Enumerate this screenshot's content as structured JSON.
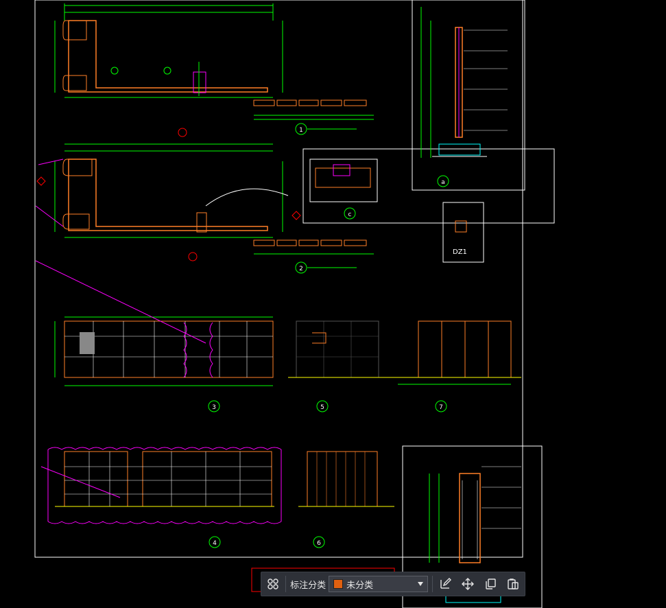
{
  "drawing": {
    "detail_labels": [
      "1",
      "2",
      "3",
      "4",
      "5",
      "6",
      "7",
      "a",
      "c"
    ],
    "dz_label": "DZ1"
  },
  "annotation_toolbar": {
    "category_label": "标注分类",
    "category_value": "未分类",
    "category_color": "#e06010",
    "icons": [
      "grid-icon",
      "edit-icon",
      "move-icon",
      "copy-icon",
      "paste-icon"
    ]
  },
  "colors": {
    "background": "#000000",
    "frame": "#ffffff",
    "dimension": "#00ff00",
    "outline": "#ff7f27",
    "magenta": "#ff00ff",
    "marker": "#ff0000"
  }
}
